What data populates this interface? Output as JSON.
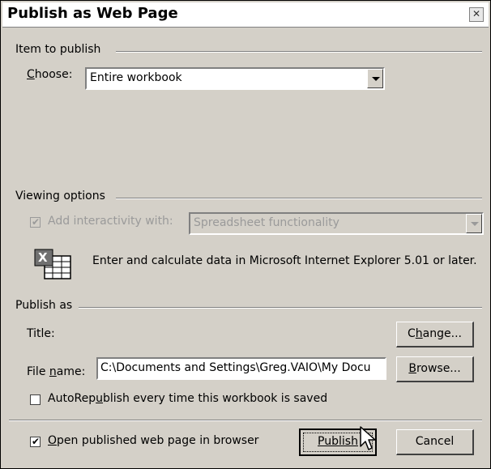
{
  "window": {
    "title": "Publish as Web Page",
    "close_icon": "close-icon"
  },
  "item_to_publish": {
    "heading": "Item to publish",
    "choose_label": "Choose:",
    "choose_value": "Entire workbook"
  },
  "viewing_options": {
    "heading": "Viewing options",
    "interactivity_checked": true,
    "interactivity_label": "Add interactivity with:",
    "interactivity_value": "Spreadsheet functionality",
    "description": "Enter and calculate data in Microsoft Internet Explorer 5.01 or later.",
    "icon": "excel-spreadsheet-icon"
  },
  "publish_as": {
    "heading": "Publish as",
    "title_label": "Title:",
    "change_button": "Change...",
    "file_name_label": "File name:",
    "file_name_value": "C:\\Documents and Settings\\Greg.VAIO\\My Docu",
    "browse_button": "Browse...",
    "autorepublish_checked": false,
    "autorepublish_label": "AutoRepublish every time this workbook is saved"
  },
  "footer": {
    "open_in_browser_checked": true,
    "open_in_browser_label": "Open published web page in browser",
    "publish_button": "Publish",
    "cancel_button": "Cancel"
  }
}
